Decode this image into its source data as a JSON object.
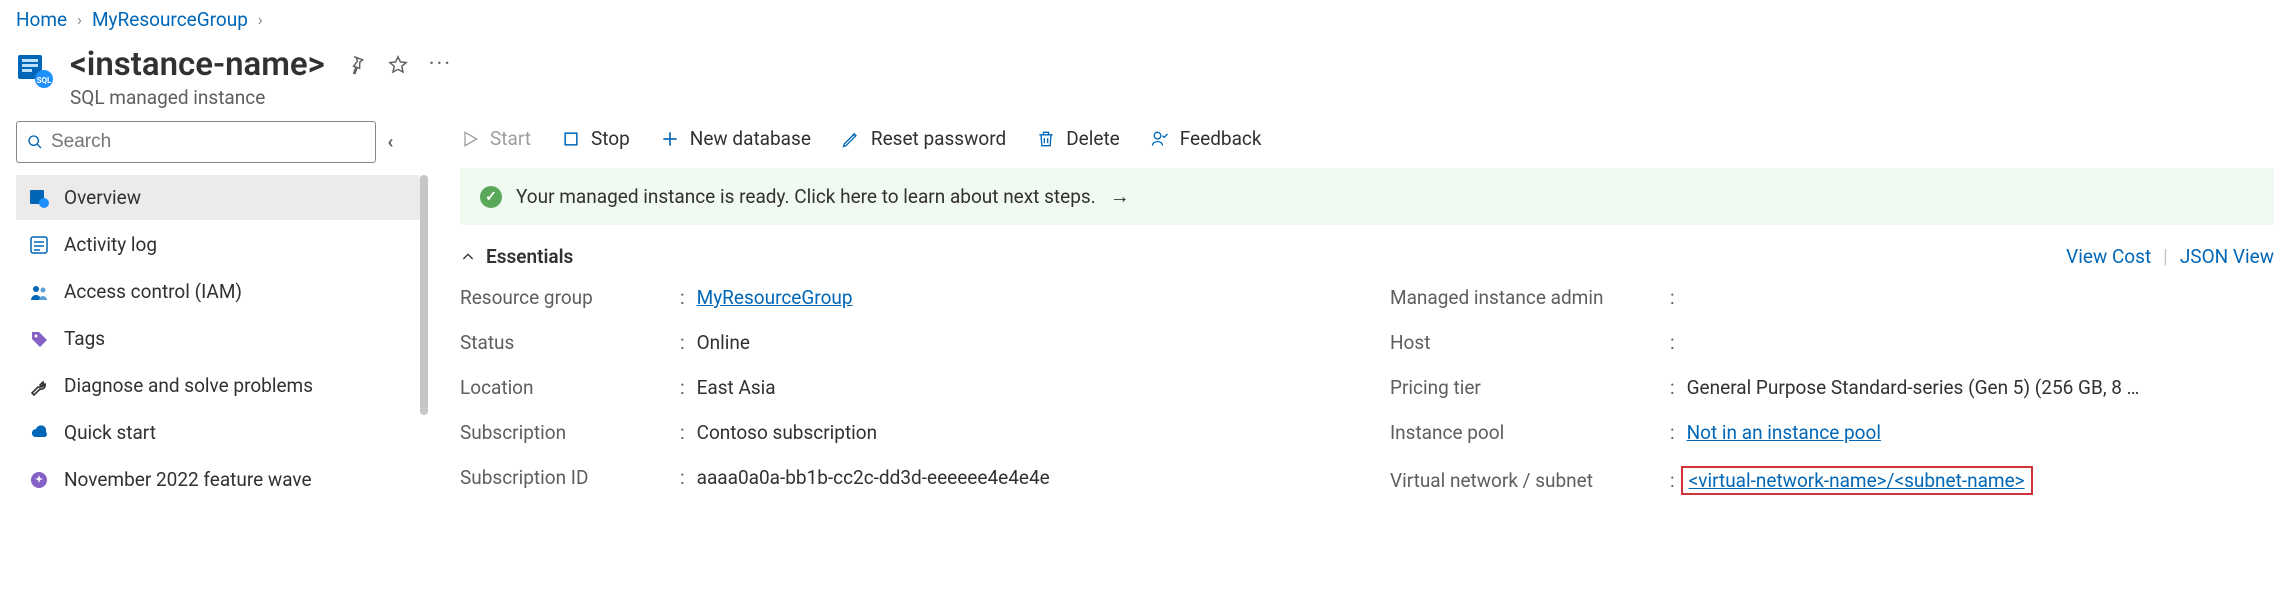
{
  "breadcrumb": {
    "home": "Home",
    "rg": "MyResourceGroup"
  },
  "header": {
    "title": "<instance-name>",
    "subtitle": "SQL managed instance"
  },
  "search": {
    "placeholder": "Search"
  },
  "sidebar": {
    "items": [
      {
        "label": "Overview"
      },
      {
        "label": "Activity log"
      },
      {
        "label": "Access control (IAM)"
      },
      {
        "label": "Tags"
      },
      {
        "label": "Diagnose and solve problems"
      },
      {
        "label": "Quick start"
      },
      {
        "label": "November 2022 feature wave"
      }
    ]
  },
  "commands": {
    "start": "Start",
    "stop": "Stop",
    "newdb": "New database",
    "reset": "Reset password",
    "delete": "Delete",
    "feedback": "Feedback"
  },
  "banner": {
    "message": "Your managed instance is ready. Click here to learn about next steps."
  },
  "essentials": {
    "heading": "Essentials",
    "view_cost": "View Cost",
    "json_view": "JSON View",
    "left": {
      "resource_group_label": "Resource group",
      "resource_group_value": "MyResourceGroup",
      "status_label": "Status",
      "status_value": "Online",
      "location_label": "Location",
      "location_value": "East Asia",
      "subscription_label": "Subscription",
      "subscription_value": "Contoso subscription",
      "subscription_id_label": "Subscription ID",
      "subscription_id_value": "aaaa0a0a-bb1b-cc2c-dd3d-eeeeee4e4e4e"
    },
    "right": {
      "admin_label": "Managed instance admin",
      "admin_value": "",
      "host_label": "Host",
      "host_value": "",
      "pricing_label": "Pricing tier",
      "pricing_value": "General Purpose Standard-series (Gen 5) (256 GB, 8 …",
      "pool_label": "Instance pool",
      "pool_value": "Not in an instance pool",
      "vnet_label": "Virtual network / subnet",
      "vnet_value": "<virtual-network-name>/<subnet-name>"
    }
  }
}
